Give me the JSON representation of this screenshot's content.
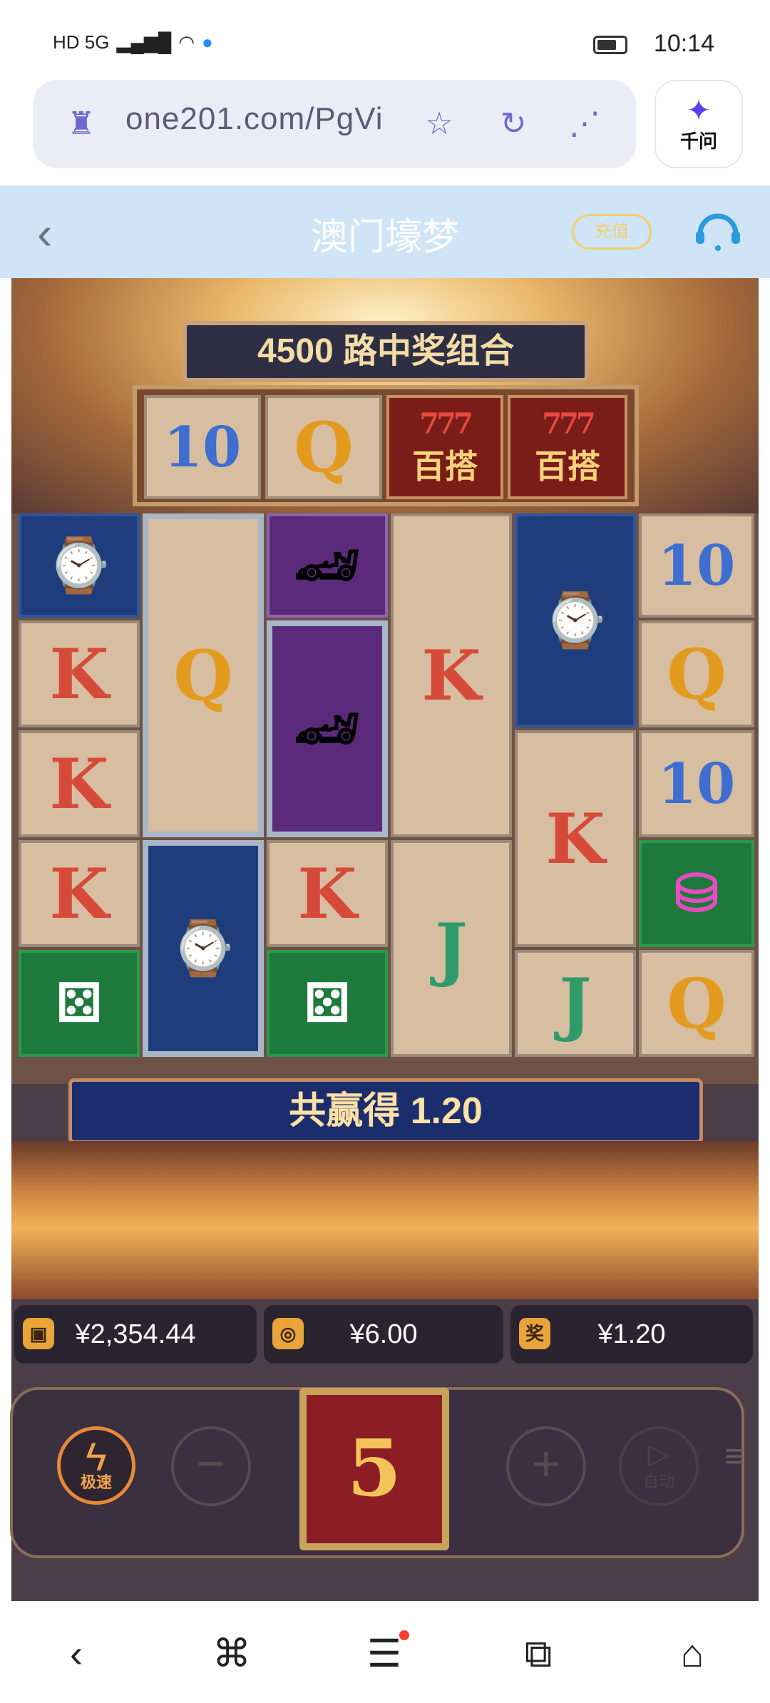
{
  "status_bar": {
    "left_indicators": "HD 5G",
    "time": "10:14"
  },
  "browser": {
    "url": "one201.com/PgVi",
    "assistant_label": "千问"
  },
  "header": {
    "back_glyph": "‹",
    "title": "澳门壕梦",
    "recharge_label": "充值"
  },
  "game": {
    "ways_banner": "4500 路中奖组合",
    "top_reel": [
      {
        "symbol": "10"
      },
      {
        "symbol": "Q"
      },
      {
        "symbol": "百搭",
        "top": "777"
      },
      {
        "symbol": "百搭",
        "top": "777"
      }
    ],
    "reels": [
      [
        "watch",
        "K",
        "K",
        "K",
        "dice"
      ],
      [
        "Q",
        "watch"
      ],
      [
        "car",
        "car",
        "K",
        "dice"
      ],
      [
        "K",
        "J"
      ],
      [
        "watch",
        "K",
        "J"
      ],
      [
        "10",
        "Q",
        "10",
        "chips",
        "Q"
      ]
    ],
    "win_label": "共赢得 1.20",
    "balance": "¥2,354.44",
    "bet": "¥6.00",
    "win_amount": "¥1.20",
    "win_icon_label": "奖",
    "turbo_label": "极速",
    "auto_label": "自动",
    "spin_value": "5",
    "minus_label": "−",
    "plus_label": "+"
  },
  "icons": {
    "back": "chevron-left-icon",
    "star": "star-check-icon",
    "refresh": "refresh-icon",
    "share": "share-icon",
    "home": "home-icon"
  }
}
